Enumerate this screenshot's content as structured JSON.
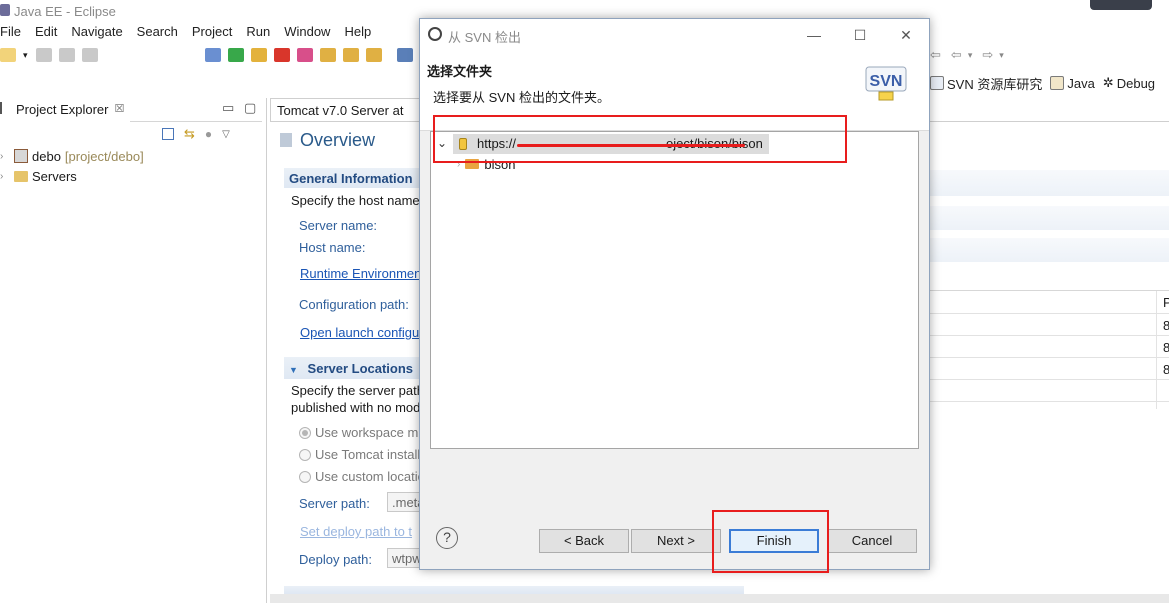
{
  "window": {
    "title": "Java EE - Eclipse"
  },
  "menu": [
    "File",
    "Edit",
    "Navigate",
    "Search",
    "Project",
    "Run",
    "Window",
    "Help"
  ],
  "perspectives": [
    {
      "label": "SVN 资源库研究",
      "icon": "svn-repo-icon"
    },
    {
      "label": "Java",
      "icon": "java-perspective-icon"
    },
    {
      "label": "Debug",
      "icon": "debug-perspective-icon"
    }
  ],
  "project_explorer": {
    "tab_label": "Project Explorer",
    "tab_close": "☒",
    "items": [
      {
        "name": "debo",
        "suffix": "[project/debo]"
      },
      {
        "name": "Servers",
        "suffix": ""
      }
    ]
  },
  "editor": {
    "tab_label": "Tomcat v7.0 Server at",
    "overview_title": "Overview",
    "general_info": {
      "title": "General Information",
      "desc": "Specify the host name",
      "server_name_label": "Server name:",
      "host_name_label": "Host name:",
      "runtime_env_link": "Runtime Environment",
      "config_path_label": "Configuration path:",
      "open_launch_link": "Open launch configu"
    },
    "server_locations": {
      "title": "Server Locations",
      "desc_line1": "Specify the server path",
      "desc_line2": "published with no mod",
      "options": [
        "Use workspace m",
        "Use Tomcat install",
        "Use custom locatio"
      ],
      "server_path_label": "Server path:",
      "server_path_value": ".meta",
      "set_deploy_link": "Set deploy path to t",
      "deploy_path_label": "Deploy path:",
      "deploy_path_value": "wtpw"
    },
    "right_column_values": [
      "P",
      "8",
      "8",
      "8"
    ]
  },
  "dialog": {
    "title": "从 SVN 检出",
    "header_title": "选择文件夹",
    "header_subtitle": "选择要从 SVN 检出的文件夹。",
    "logo_text": "SVN",
    "tree": {
      "root_prefix": "https://",
      "root_suffix": "oject/bison/bison",
      "child": "bison"
    },
    "buttons": {
      "back": "< Back",
      "next": "Next >",
      "finish": "Finish",
      "cancel": "Cancel"
    },
    "help_symbol": "?"
  },
  "colors": {
    "annotation_red": "#e81d1d",
    "section_blue": "#234b82",
    "link_blue": "#1a55b5"
  }
}
